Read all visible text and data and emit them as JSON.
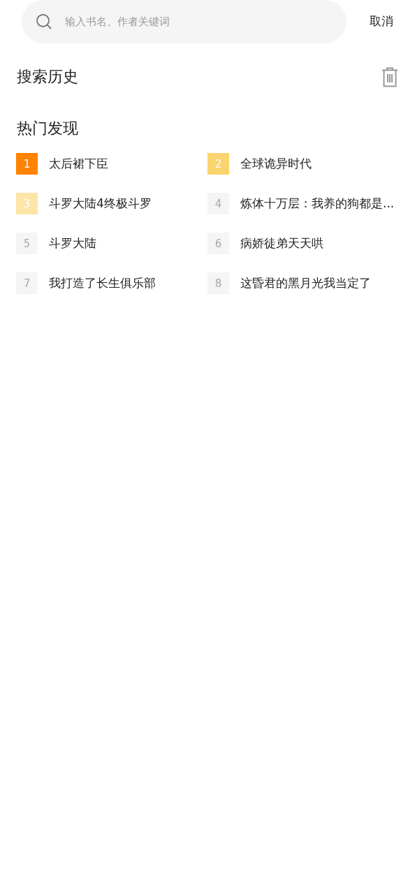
{
  "search": {
    "placeholder": "输入书名、作者关键词"
  },
  "cancel": "取消",
  "history": {
    "title": "搜索历史"
  },
  "hot": {
    "title": "热门发现",
    "items": [
      {
        "rank": "1",
        "title": "太后裙下臣",
        "color": "#ff8200"
      },
      {
        "rank": "2",
        "title": "全球诡异时代",
        "color": "#fad46f"
      },
      {
        "rank": "3",
        "title": "斗罗大陆4终极斗罗",
        "color": "#fde4a8"
      },
      {
        "rank": "4",
        "title": "炼体十万层：我养的狗都是...",
        "color": "#f5f5f5"
      },
      {
        "rank": "5",
        "title": "斗罗大陆",
        "color": "#f5f5f5"
      },
      {
        "rank": "6",
        "title": "病娇徒弟天天哄",
        "color": "#f5f5f5"
      },
      {
        "rank": "7",
        "title": "我打造了长生俱乐部",
        "color": "#f5f5f5"
      },
      {
        "rank": "8",
        "title": "这昏君的黑月光我当定了",
        "color": "#f5f5f5"
      }
    ]
  }
}
